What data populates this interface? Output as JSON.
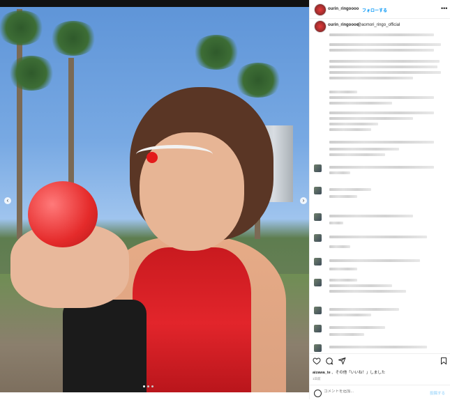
{
  "post": {
    "username": "ourin_ringoooo",
    "follow_label": "フォローする",
    "more_icon": "more-horizontal-icon",
    "caption_username": "ourin_ringoooo",
    "caption_mention": "@aomori_ringo_official",
    "likes_user": "aizawa_te",
    "likes_suffix": " 、その他",
    "likes_quote": "「いいね！」",
    "likes_end": "しました",
    "time_label": "1日前"
  },
  "comment_box": {
    "placeholder": "コメントを追加...",
    "post_label": "投稿する"
  },
  "icons": {
    "like": "heart-icon",
    "comment": "comment-icon",
    "share": "share-icon",
    "save": "bookmark-icon",
    "emoji": "emoji-icon",
    "prev": "chevron-left-icon",
    "next": "chevron-right-icon"
  },
  "colors": {
    "follow_blue": "#0095f6",
    "post_button_disabled": "#b2dffc"
  }
}
